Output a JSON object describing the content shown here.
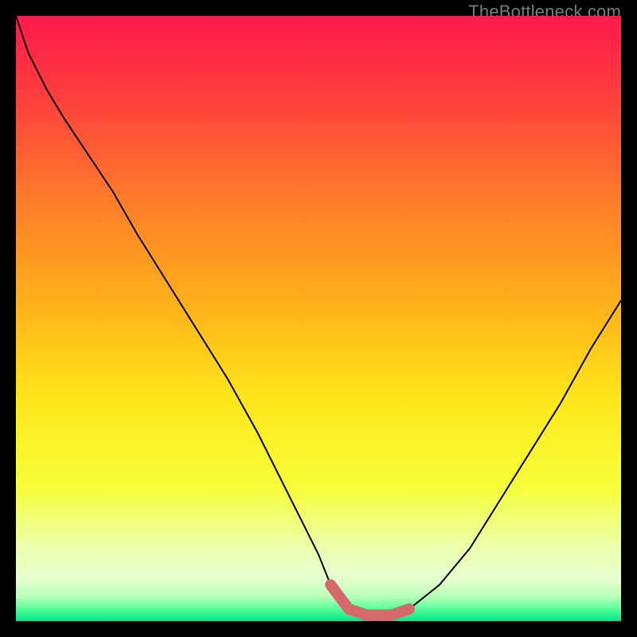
{
  "watermark": "TheBottleneck.com",
  "colors": {
    "gradient_top": "#ff1a4b",
    "gradient_bottom": "#00e58a",
    "curve": "#000000",
    "marker": "#d66a6a",
    "frame": "#000000"
  },
  "chart_data": {
    "type": "line",
    "title": "",
    "xlabel": "",
    "ylabel": "",
    "xlim": [
      0,
      100
    ],
    "ylim": [
      0,
      100
    ],
    "grid": false,
    "series": [
      {
        "name": "bottleneck-curve",
        "x": [
          0,
          2,
          5,
          8,
          12,
          16,
          20,
          25,
          30,
          35,
          40,
          45,
          50,
          52,
          55,
          58,
          62,
          65,
          70,
          75,
          80,
          85,
          90,
          95,
          100
        ],
        "y": [
          100,
          94,
          88,
          83,
          77,
          71,
          64,
          56,
          48,
          40,
          31,
          21,
          11,
          6,
          2,
          1,
          1,
          2,
          6,
          12,
          20,
          28,
          36,
          45,
          53
        ]
      }
    ],
    "sweet_spot": {
      "x": [
        52,
        55,
        58,
        62,
        65
      ],
      "y": [
        6,
        2,
        1,
        1,
        2
      ]
    }
  }
}
